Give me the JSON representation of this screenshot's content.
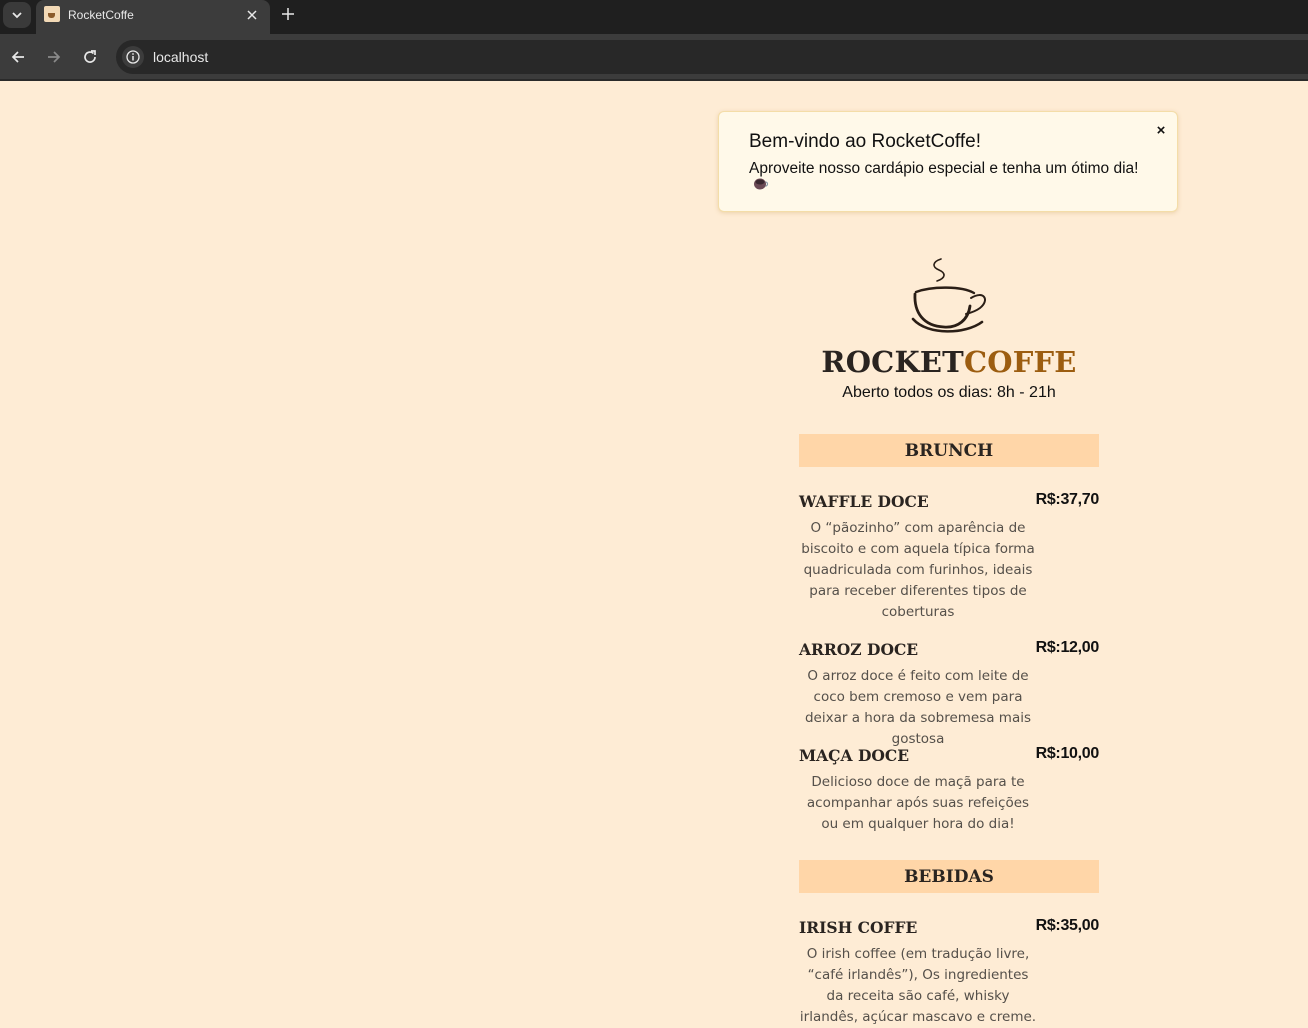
{
  "browser": {
    "tab_title": "RocketCoffe",
    "url": "localhost"
  },
  "toast": {
    "title": "Bem-vindo ao RocketCoffe!",
    "message": "Aproveite nosso cardápio especial e tenha um ótimo dia!",
    "emoji": "☕",
    "close_label": "×"
  },
  "menu": {
    "logo_icon": "coffee-cup-icon",
    "brand_primary": "ROCKET",
    "brand_accent": "COFFE",
    "hours": "Aberto todos os dias: 8h - 21h",
    "sections": [
      {
        "title": "BRUNCH",
        "items": [
          {
            "name": "WAFFLE DOCE",
            "price": "R$:37,70",
            "description": "O “pãozinho” com aparência de biscoito e com aquela típica forma quadriculada com furinhos, ideais para receber diferentes tipos de coberturas"
          },
          {
            "name": "ARROZ DOCE",
            "price": "R$:12,00",
            "description": "O arroz doce é feito com leite de coco bem cremoso e vem para deixar a hora da sobremesa mais gostosa"
          },
          {
            "name": "MAÇA DOCE",
            "price": "R$:10,00",
            "description": "Delicioso doce de maçã para te acompanhar após suas refeições ou em qualquer hora do dia!"
          }
        ]
      },
      {
        "title": "BEBIDAS",
        "items": [
          {
            "name": "IRISH COFFE",
            "price": "R$:35,00",
            "description": "O irish coffee (em tradução livre, “café irlandês”), Os ingredientes da receita são café, whisky irlandês, açúcar mascavo e creme."
          }
        ]
      }
    ]
  },
  "colors": {
    "page_background": "#feecd5",
    "section_bar": "#ffd6a8",
    "brand_accent": "#9c5d10",
    "toast_background": "#fff9e9"
  }
}
